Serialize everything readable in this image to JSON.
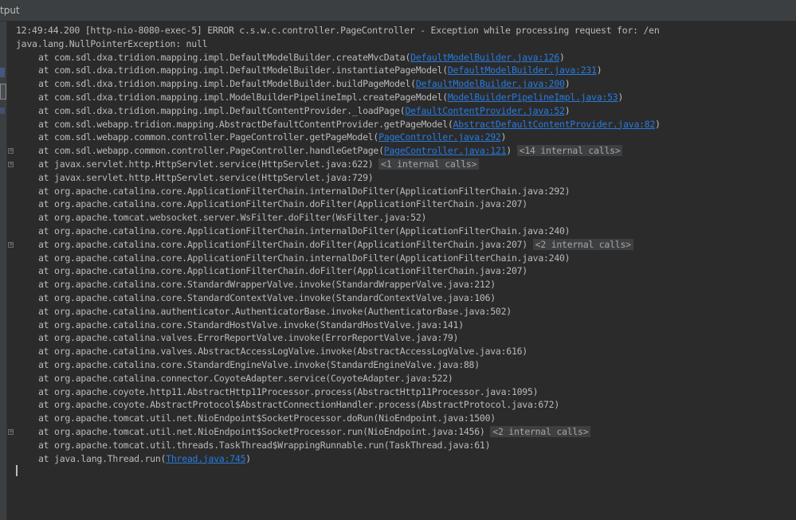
{
  "window": {
    "title": "tput"
  },
  "console": {
    "header_lines": [
      "12:49:44.200 [http-nio-8080-exec-5] ERROR c.s.w.c.controller.PageController - Exception while processing request for: /en",
      "java.lang.NullPointerException: null"
    ],
    "frames": [
      {
        "text": "at com.sdl.dxa.tridion.mapping.impl.DefaultModelBuilder.createMvcData(",
        "link": "DefaultModelBuilder.java:126",
        "suffix": ")"
      },
      {
        "text": "at com.sdl.dxa.tridion.mapping.impl.DefaultModelBuilder.instantiatePageModel(",
        "link": "DefaultModelBuilder.java:231",
        "suffix": ")"
      },
      {
        "text": "at com.sdl.dxa.tridion.mapping.impl.DefaultModelBuilder.buildPageModel(",
        "link": "DefaultModelBuilder.java:200",
        "suffix": ")"
      },
      {
        "text": "at com.sdl.dxa.tridion.mapping.impl.ModelBuilderPipelineImpl.createPageModel(",
        "link": "ModelBuilderPipelineImpl.java:53",
        "suffix": ")"
      },
      {
        "text": "at com.sdl.dxa.tridion.mapping.impl.DefaultContentProvider._loadPage(",
        "link": "DefaultContentProvider.java:52",
        "suffix": ")"
      },
      {
        "text": "at com.sdl.webapp.tridion.mapping.AbstractDefaultContentProvider.getPageModel(",
        "link": "AbstractDefaultContentProvider.java:82",
        "suffix": ")"
      },
      {
        "text": "at com.sdl.webapp.common.controller.PageController.getPageModel(",
        "link": "PageController.java:292",
        "suffix": ")"
      },
      {
        "text": "at com.sdl.webapp.common.controller.PageController.handleGetPage(",
        "link": "PageController.java:121",
        "suffix": ")",
        "internal": "<14 internal calls>",
        "fold": true
      },
      {
        "text": "at javax.servlet.http.HttpServlet.service(HttpServlet.java:622)",
        "internal": "<1 internal calls>",
        "fold": true
      },
      {
        "text": "at javax.servlet.http.HttpServlet.service(HttpServlet.java:729)"
      },
      {
        "text": "at org.apache.catalina.core.ApplicationFilterChain.internalDoFilter(ApplicationFilterChain.java:292)"
      },
      {
        "text": "at org.apache.catalina.core.ApplicationFilterChain.doFilter(ApplicationFilterChain.java:207)"
      },
      {
        "text": "at org.apache.tomcat.websocket.server.WsFilter.doFilter(WsFilter.java:52)"
      },
      {
        "text": "at org.apache.catalina.core.ApplicationFilterChain.internalDoFilter(ApplicationFilterChain.java:240)"
      },
      {
        "text": "at org.apache.catalina.core.ApplicationFilterChain.doFilter(ApplicationFilterChain.java:207)",
        "internal": "<2 internal calls>",
        "fold": true
      },
      {
        "text": "at org.apache.catalina.core.ApplicationFilterChain.internalDoFilter(ApplicationFilterChain.java:240)"
      },
      {
        "text": "at org.apache.catalina.core.ApplicationFilterChain.doFilter(ApplicationFilterChain.java:207)"
      },
      {
        "text": "at org.apache.catalina.core.StandardWrapperValve.invoke(StandardWrapperValve.java:212)"
      },
      {
        "text": "at org.apache.catalina.core.StandardContextValve.invoke(StandardContextValve.java:106)"
      },
      {
        "text": "at org.apache.catalina.authenticator.AuthenticatorBase.invoke(AuthenticatorBase.java:502)"
      },
      {
        "text": "at org.apache.catalina.core.StandardHostValve.invoke(StandardHostValve.java:141)"
      },
      {
        "text": "at org.apache.catalina.valves.ErrorReportValve.invoke(ErrorReportValve.java:79)"
      },
      {
        "text": "at org.apache.catalina.valves.AbstractAccessLogValve.invoke(AbstractAccessLogValve.java:616)"
      },
      {
        "text": "at org.apache.catalina.core.StandardEngineValve.invoke(StandardEngineValve.java:88)"
      },
      {
        "text": "at org.apache.catalina.connector.CoyoteAdapter.service(CoyoteAdapter.java:522)"
      },
      {
        "text": "at org.apache.coyote.http11.AbstractHttp11Processor.process(AbstractHttp11Processor.java:1095)"
      },
      {
        "text": "at org.apache.coyote.AbstractProtocol$AbstractConnectionHandler.process(AbstractProtocol.java:672)"
      },
      {
        "text": "at org.apache.tomcat.util.net.NioEndpoint$SocketProcessor.doRun(NioEndpoint.java:1500)"
      },
      {
        "text": "at org.apache.tomcat.util.net.NioEndpoint$SocketProcessor.run(NioEndpoint.java:1456)",
        "internal": "<2 internal calls>",
        "fold": true
      },
      {
        "text": "at org.apache.tomcat.util.threads.TaskThread$WrappingRunnable.run(TaskThread.java:61)"
      },
      {
        "text": "at java.lang.Thread.run(",
        "link": "Thread.java:745",
        "suffix": ")"
      }
    ]
  },
  "colors": {
    "background": "#2b2b2b",
    "text": "#bbbbbb",
    "link": "#287bde",
    "internal_bg": "#3d3f41"
  },
  "icons": {
    "fold": "plus-box-icon"
  }
}
